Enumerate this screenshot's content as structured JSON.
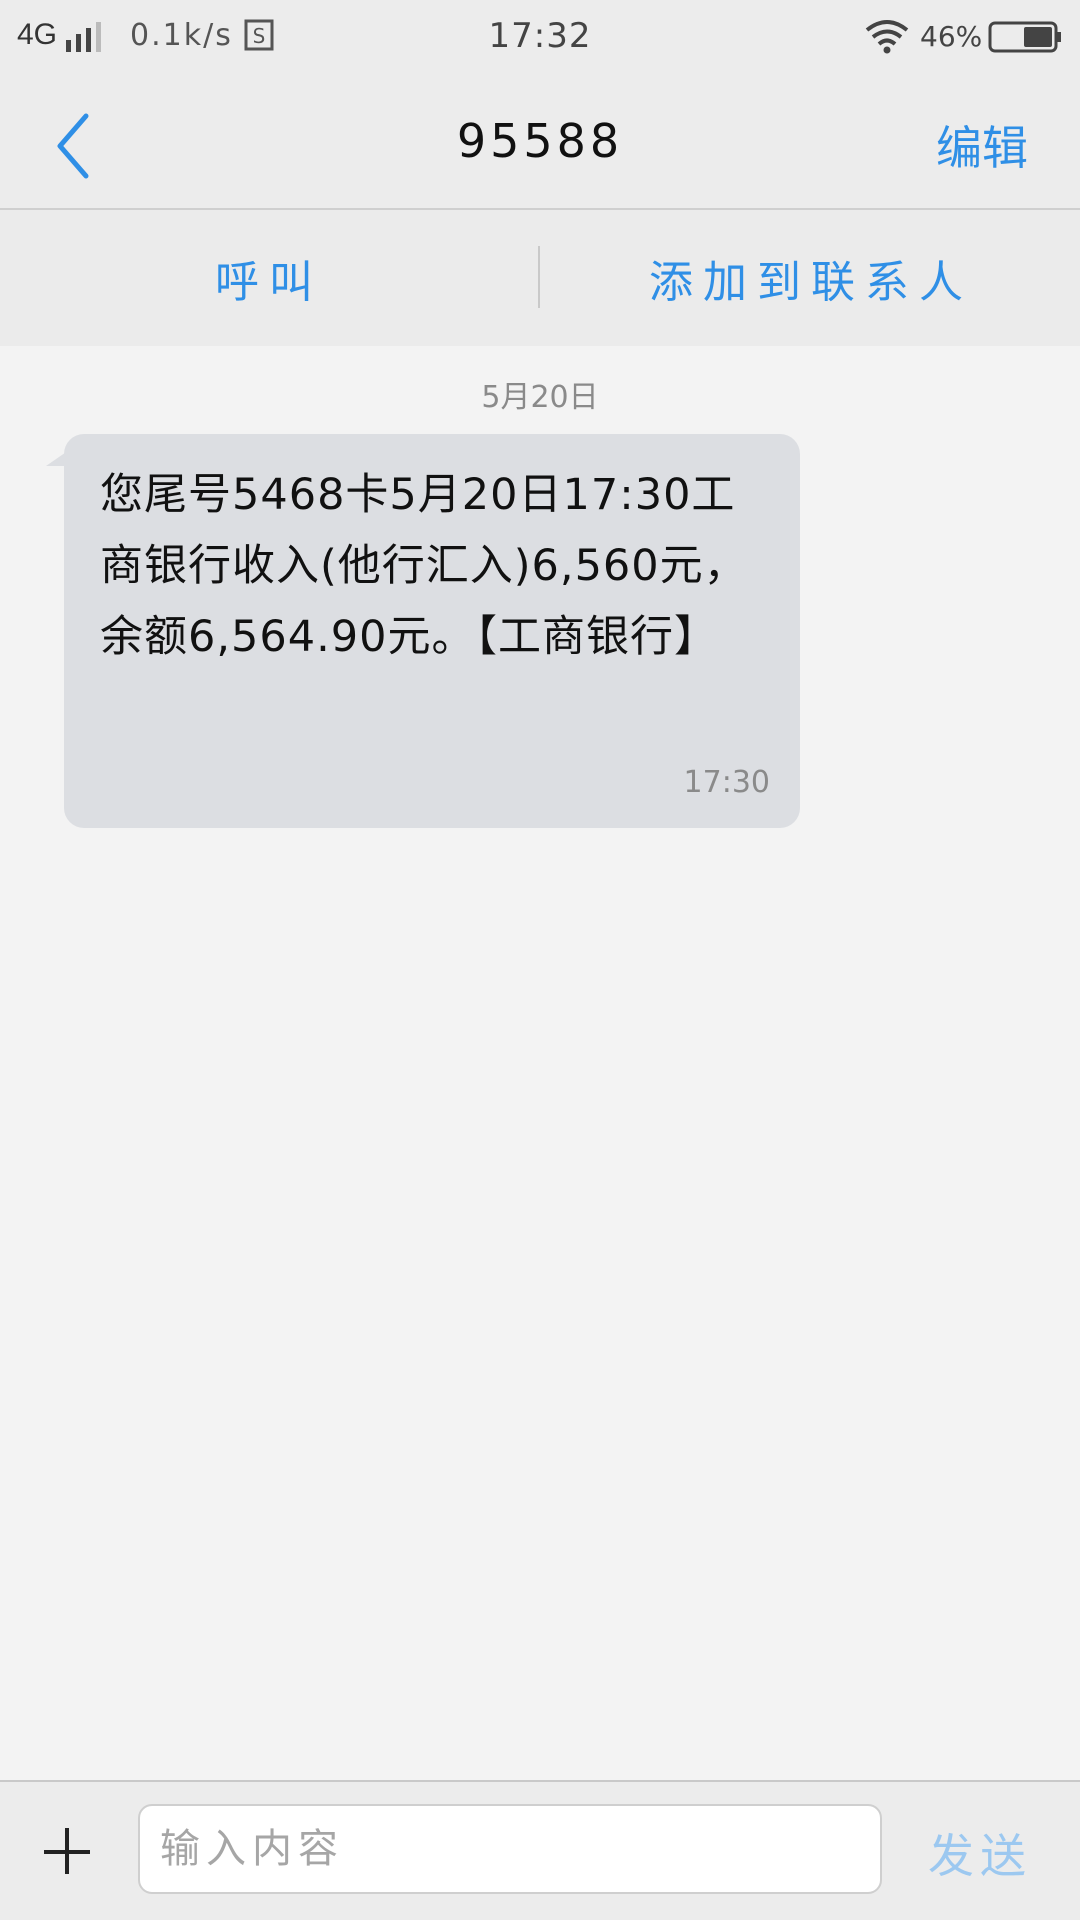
{
  "status_bar": {
    "network": "4G",
    "speed": "0.1k/s",
    "time": "17:32",
    "battery_percent": "46%"
  },
  "header": {
    "title": "95588",
    "edit_label": "编辑"
  },
  "actions": {
    "call_label": "呼叫",
    "add_contact_label": "添加到联系人"
  },
  "conversation": {
    "date_label": "5月20日",
    "messages": [
      {
        "text": "您尾号5468卡5月20日17:30工商银行收入(他行汇入)6,560元，余额6,564.90元。【工商银行】",
        "time": "17:30"
      }
    ]
  },
  "composer": {
    "placeholder": "输入内容",
    "send_label": "发送"
  },
  "colors": {
    "accent": "#2f8fe6",
    "bubble": "#dcdee2",
    "background": "#f3f3f3"
  },
  "icons": {
    "back": "chevron-left-icon",
    "add": "plus-icon",
    "signal": "signal-icon",
    "wifi": "wifi-icon",
    "battery": "battery-icon",
    "sim": "sim-icon"
  }
}
